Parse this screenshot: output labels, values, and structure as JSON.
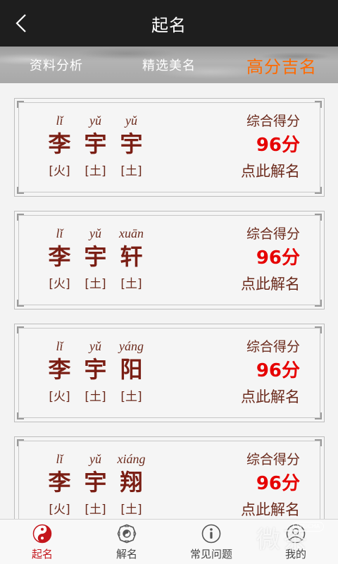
{
  "header": {
    "title": "起名"
  },
  "tabs": [
    {
      "label": "资料分析",
      "active": false
    },
    {
      "label": "精选美名",
      "active": false
    },
    {
      "label": "高分吉名",
      "active": true
    }
  ],
  "cards": [
    {
      "chars": [
        {
          "pinyin": "lǐ",
          "hanzi": "李",
          "element": "[火]"
        },
        {
          "pinyin": "yǔ",
          "hanzi": "宇",
          "element": "[土]"
        },
        {
          "pinyin": "yǔ",
          "hanzi": "宇",
          "element": "[土]"
        }
      ],
      "score_label": "综合得分",
      "score": "96分",
      "detail_label": "点此解名"
    },
    {
      "chars": [
        {
          "pinyin": "lǐ",
          "hanzi": "李",
          "element": "[火]"
        },
        {
          "pinyin": "yǔ",
          "hanzi": "宇",
          "element": "[土]"
        },
        {
          "pinyin": "xuān",
          "hanzi": "轩",
          "element": "[土]"
        }
      ],
      "score_label": "综合得分",
      "score": "96分",
      "detail_label": "点此解名"
    },
    {
      "chars": [
        {
          "pinyin": "lǐ",
          "hanzi": "李",
          "element": "[火]"
        },
        {
          "pinyin": "yǔ",
          "hanzi": "宇",
          "element": "[土]"
        },
        {
          "pinyin": "yáng",
          "hanzi": "阳",
          "element": "[土]"
        }
      ],
      "score_label": "综合得分",
      "score": "96分",
      "detail_label": "点此解名"
    },
    {
      "chars": [
        {
          "pinyin": "lǐ",
          "hanzi": "李",
          "element": "[火]"
        },
        {
          "pinyin": "yǔ",
          "hanzi": "宇",
          "element": "[土]"
        },
        {
          "pinyin": "xiáng",
          "hanzi": "翔",
          "element": "[土]"
        }
      ],
      "score_label": "综合得分",
      "score": "96分",
      "detail_label": "点此解名"
    }
  ],
  "bottom_nav": [
    {
      "label": "起名",
      "icon": "yin-yang-icon",
      "active": true
    },
    {
      "label": "解名",
      "icon": "bagua-icon",
      "active": false
    },
    {
      "label": "常见问题",
      "icon": "info-icon",
      "active": false
    },
    {
      "label": "我的",
      "icon": "user-icon",
      "active": false
    }
  ],
  "watermark": {
    "text": "微茶",
    "badge": "WEICHA"
  },
  "colors": {
    "header_bg": "#1e1e1e",
    "active_tab": "#ff6a00",
    "score": "#e60000",
    "hanzi": "#7a1e14",
    "nav_active": "#c4161c"
  }
}
